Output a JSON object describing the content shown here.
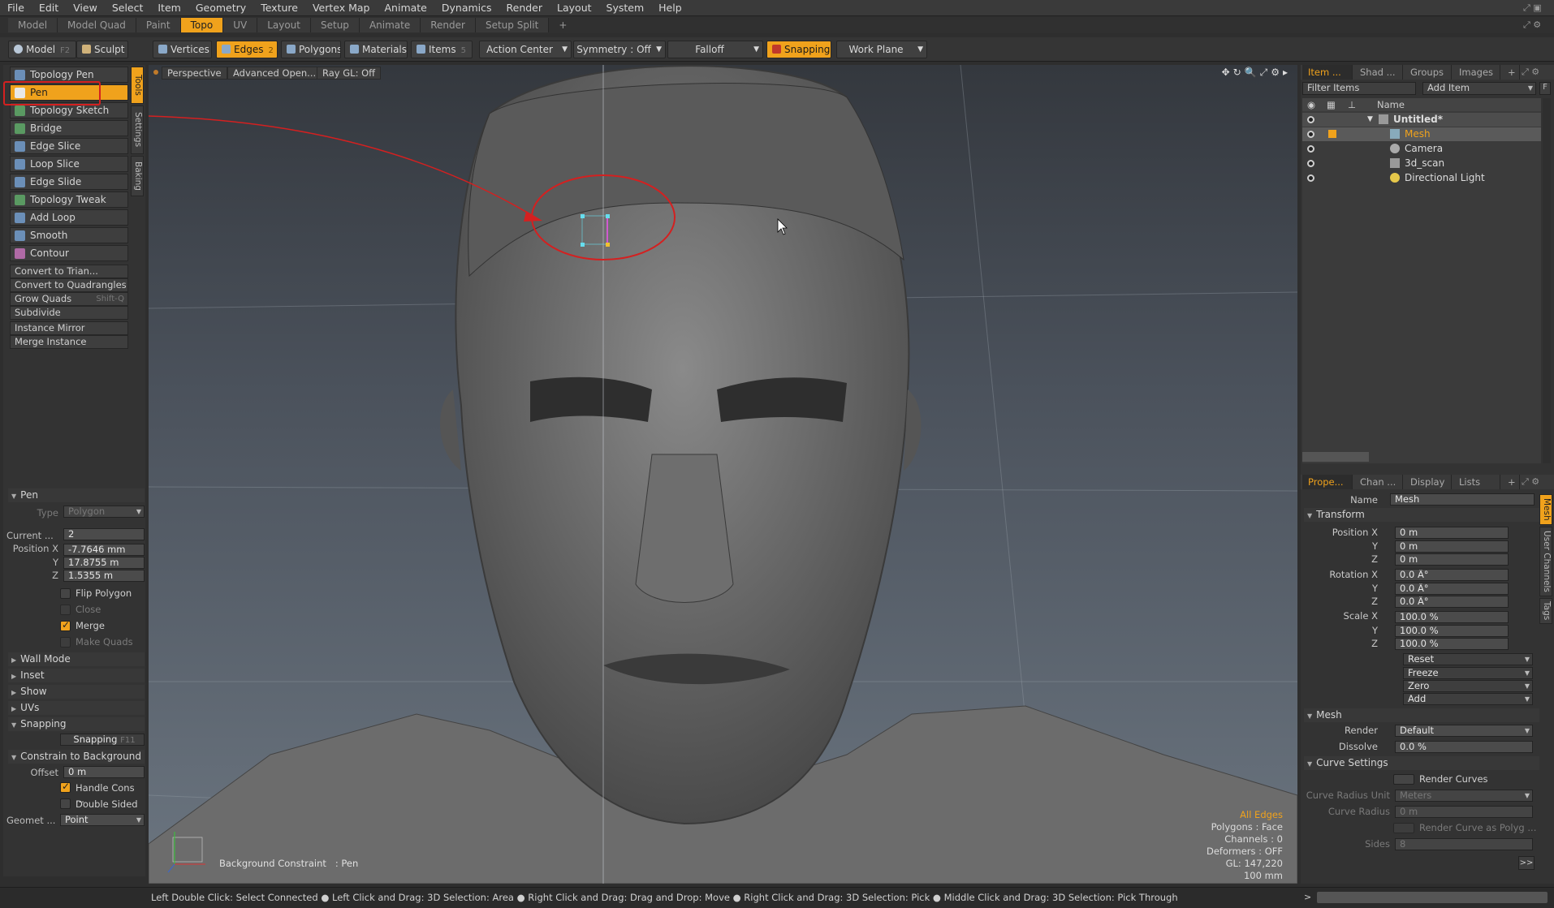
{
  "menu": [
    "File",
    "Edit",
    "View",
    "Select",
    "Item",
    "Geometry",
    "Texture",
    "Vertex Map",
    "Animate",
    "Dynamics",
    "Render",
    "Layout",
    "System",
    "Help"
  ],
  "layout_tabs": [
    "Model",
    "Model Quad",
    "Paint",
    "Topo",
    "UV",
    "Layout",
    "Setup",
    "Animate",
    "Render",
    "Setup Split",
    "+"
  ],
  "toolbar": {
    "model": "Model",
    "model_key": "F2",
    "sculpt": "Sculpt",
    "vertices": "Vertices",
    "edges": "Edges",
    "edges_count": "2",
    "polygons": "Polygons",
    "materials": "Materials",
    "items": "Items",
    "items_count": "5",
    "action_center": "Action Center",
    "symmetry": "Symmetry : Off",
    "falloff": "Falloff",
    "snapping": "Snapping",
    "work_plane": "Work Plane"
  },
  "tools": [
    "Topology Pen",
    "Pen",
    "Topology Sketch",
    "Bridge",
    "Edge Slice",
    "Loop Slice",
    "Edge Slide",
    "Topology Tweak",
    "Add Loop",
    "Smooth",
    "Contour"
  ],
  "commands": [
    "Convert to Trian...",
    "Convert to Quadrangles",
    "Grow Quads",
    "Subdivide",
    "Instance Mirror",
    "Merge Instance"
  ],
  "grow_quads_key": "Shift-Q",
  "side_tabs": [
    "Tools",
    "Settings",
    "Baking"
  ],
  "pen_props": {
    "title": "Pen",
    "type_label": "Type",
    "type_value": "Polygon",
    "current_label": "Current ...",
    "current_value": "2",
    "pos_label": "Position X",
    "pos_x": "-7.7646 mm",
    "y_label": "Y",
    "pos_y": "17.8755 m",
    "z_label": "Z",
    "pos_z": "1.5355 m",
    "flip_polygon": "Flip Polygon",
    "close": "Close",
    "merge": "Merge",
    "make_quads": "Make Quads",
    "wall_mode": "Wall Mode",
    "inset": "Inset",
    "show": "Show",
    "uvs": "UVs",
    "snapping": "Snapping",
    "snapping_btn": "Snapping",
    "snapping_key": "F11",
    "constrain": "Constrain to Background",
    "offset_label": "Offset",
    "offset_value": "0 m",
    "handle_cons": "Handle Cons ...",
    "double_sided": "Double Sided",
    "geom_label": "Geomet ...",
    "geom_value": "Point"
  },
  "viewport": {
    "perspective": "Perspective",
    "advanced": "Advanced Open...",
    "raygl": "Ray GL: Off",
    "constraint_label": "Background Constraint",
    "constraint_value": ": Pen",
    "stats": [
      "All Edges",
      "Polygons : Face",
      "Channels : 0",
      "Deformers : OFF",
      "GL: 147,220",
      "100 mm"
    ]
  },
  "items_panel": {
    "tabs": [
      "Item ...",
      "Shad ...",
      "Groups",
      "Images",
      "+"
    ],
    "filter": "Filter Items",
    "add_item": "Add Item",
    "name_col": "Name",
    "rows": [
      "Untitled*",
      "Mesh",
      "Camera",
      "3d_scan",
      "Directional Light"
    ]
  },
  "props_panel": {
    "tabs": [
      "Prope...",
      "Chan ...",
      "Display",
      "Lists",
      "+"
    ],
    "name_label": "Name",
    "name_value": "Mesh",
    "transform": "Transform",
    "position_x": "Position X",
    "pos": [
      "0 m",
      "0 m",
      "0 m"
    ],
    "rotation_x": "Rotation X",
    "rot": [
      "0.0 Â°",
      "0.0 Â°",
      "0.0 Â°"
    ],
    "scale_x": "Scale X",
    "scl": [
      "100.0 %",
      "100.0 %",
      "100.0 %"
    ],
    "y": "Y",
    "z": "Z",
    "buttons": [
      "Reset",
      "Freeze",
      "Zero",
      "Add"
    ],
    "mesh": "Mesh",
    "render_label": "Render",
    "render_value": "Default",
    "dissolve_label": "Dissolve",
    "dissolve_value": "0.0 %",
    "curve_settings": "Curve Settings",
    "render_curves": "Render Curves",
    "curve_radius_unit": "Curve Radius Unit",
    "curve_radius_unit_value": "Meters",
    "curve_radius": "Curve Radius",
    "curve_radius_value": "0 m",
    "render_curve_poly": "Render Curve as Polyg ...",
    "sides": "Sides",
    "sides_value": "8",
    "more": ">>",
    "side_tabs": [
      "Mesh",
      "User Channels",
      "Tags"
    ]
  },
  "status": "Left Double Click: Select Connected ● Left Click and Drag: 3D Selection: Area ● Right Click and Drag: Drag and Drop: Move ● Right Click and Drag: 3D Selection: Pick ● Middle Click and Drag: 3D Selection: Pick Through",
  "status_right": ">",
  "colors": {
    "accent": "#f0a21c",
    "annotation": "#d42020"
  }
}
